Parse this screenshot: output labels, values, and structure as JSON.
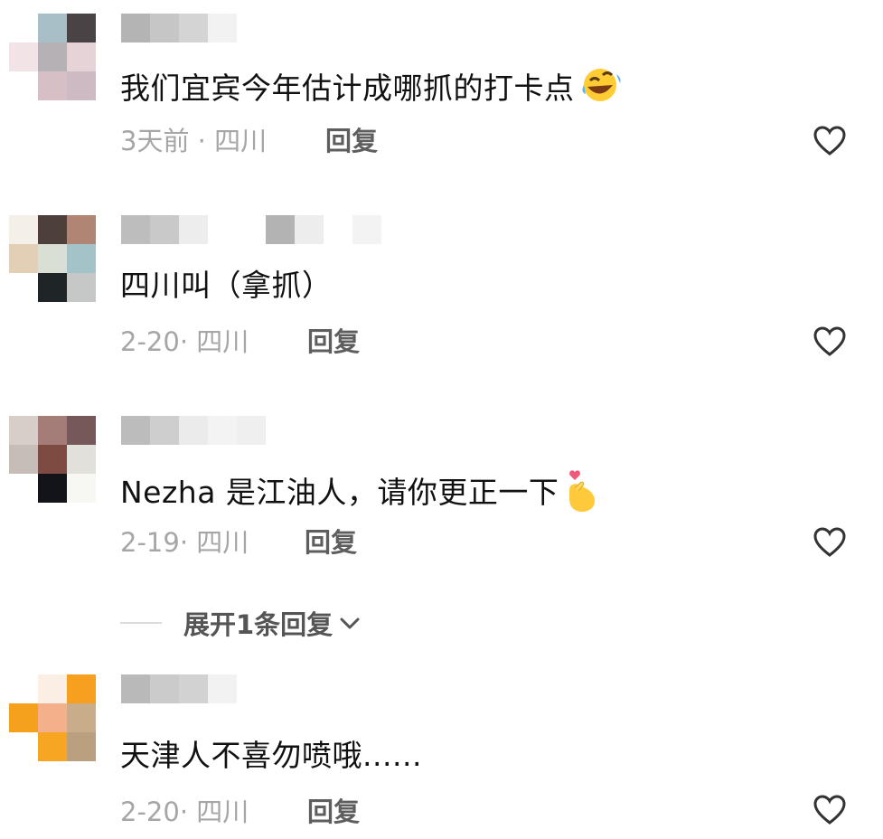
{
  "comments": [
    {
      "text": "我们宜宾今年估计成哪抓的打卡点",
      "emoji": "rofl-emoji",
      "date": "3天前",
      "location": "四川",
      "reply_label": "回复"
    },
    {
      "text": "四川叫（拿抓）",
      "emoji": "",
      "date": "2-20",
      "location": "四川",
      "reply_label": "回复"
    },
    {
      "text": "Nezha 是江油人，请你更正一下",
      "emoji": "heart-hands-emoji",
      "date": "2-19",
      "location": "四川",
      "reply_label": "回复"
    },
    {
      "text": "天津人不喜勿喷哦......",
      "emoji": "",
      "date": "2-20",
      "location": "四川",
      "reply_label": "回复"
    }
  ],
  "expand_replies": {
    "label": "展开1条回复"
  },
  "colors": {
    "meta": "#a6a6a6",
    "reply": "#5e5e5e",
    "heart_stroke": "#333333"
  }
}
